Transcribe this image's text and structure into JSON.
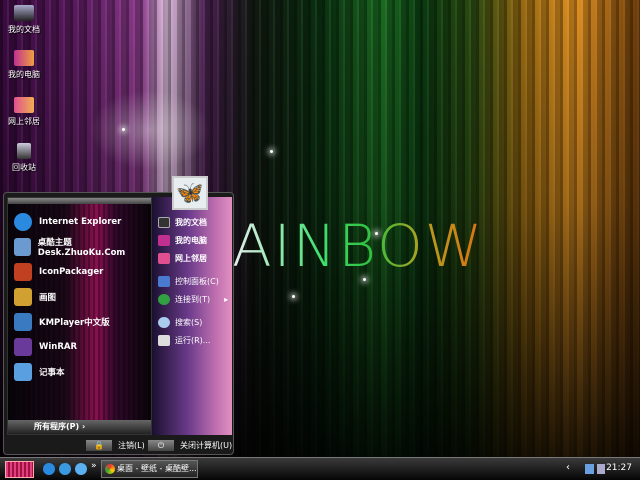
{
  "desktop": {
    "wallpaper_text": "AINBOW",
    "icons": [
      {
        "label": "我的文档"
      },
      {
        "label": "我的电脑"
      },
      {
        "label": "网上邻居"
      },
      {
        "label": "回收站"
      }
    ]
  },
  "start_menu": {
    "programs": [
      {
        "label": "Internet Explorer",
        "icon": "ie-icon",
        "color": "#2a8ae0"
      },
      {
        "label": "桌酷主题Desk.ZhuoKu.Com",
        "icon": "zhuoku-icon",
        "color": "#6a9ad0"
      },
      {
        "label": "IconPackager",
        "icon": "iconpackager-icon",
        "color": "#c04020"
      },
      {
        "label": "画图",
        "icon": "paint-icon",
        "color": "#d0a030"
      },
      {
        "label": "KMPlayer中文版",
        "icon": "kmplayer-icon",
        "color": "#3a7ac0"
      },
      {
        "label": "WinRAR",
        "icon": "winrar-icon",
        "color": "#6a3a9a"
      },
      {
        "label": "记事本",
        "icon": "notepad-icon",
        "color": "#5aa0e0"
      }
    ],
    "all_programs": "所有程序(P)",
    "all_programs_arrow": "›",
    "places": [
      {
        "label": "我的文档",
        "bold": true,
        "color": "#333"
      },
      {
        "label": "我的电脑",
        "bold": true,
        "color": "#c03090"
      },
      {
        "label": "网上邻居",
        "bold": true,
        "color": "#e05090"
      },
      {
        "label": "控制面板(C)",
        "bold": false,
        "color": "#4a7ad0"
      },
      {
        "label": "连接到(T)",
        "bold": false,
        "color": "#30a040"
      },
      {
        "label": "搜索(S)",
        "bold": false,
        "color": "#aaccee"
      },
      {
        "label": "运行(R)...",
        "bold": false,
        "color": "#ddd"
      }
    ],
    "submenu_arrow": "▸",
    "avatar_glyph": "🦋",
    "logoff": "注销(L)",
    "shutdown": "关闭计算机(U)"
  },
  "taskbar": {
    "quick_launch_more": "»",
    "task": "桌面 - 壁纸 - 桌酷壁...",
    "tray_arrow": "‹",
    "clock": "21:27"
  }
}
